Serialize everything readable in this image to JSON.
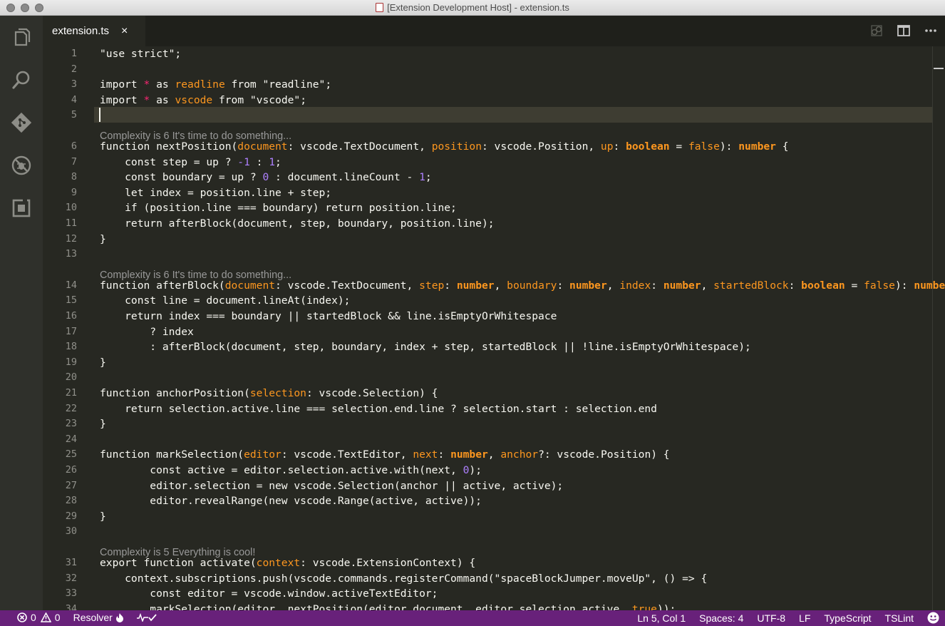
{
  "window": {
    "title": "[Extension Development Host] - extension.ts"
  },
  "activity_bar": {
    "items": [
      {
        "icon": "files-icon"
      },
      {
        "icon": "search-icon"
      },
      {
        "icon": "git-icon"
      },
      {
        "icon": "debug-icon"
      },
      {
        "icon": "extensions-icon"
      }
    ]
  },
  "tabs": [
    {
      "label": "extension.ts",
      "close": "×",
      "active": true
    }
  ],
  "editor": {
    "cursor": {
      "line": 5,
      "column": 1
    },
    "lines": [
      {
        "n": "1",
        "tokens": [
          [
            "\"use strict\";",
            "def"
          ]
        ]
      },
      {
        "n": "2",
        "tokens": []
      },
      {
        "n": "3",
        "tokens": [
          [
            "import ",
            "def"
          ],
          [
            "*",
            "op"
          ],
          [
            " as ",
            "def"
          ],
          [
            "readline",
            "ns"
          ],
          [
            " from \"readline\";",
            "def"
          ]
        ]
      },
      {
        "n": "4",
        "tokens": [
          [
            "import ",
            "def"
          ],
          [
            "*",
            "op"
          ],
          [
            " as ",
            "def"
          ],
          [
            "vscode",
            "ns"
          ],
          [
            " from \"vscode\";",
            "def"
          ]
        ]
      },
      {
        "n": "5",
        "tokens": []
      },
      {
        "lens": "Complexity is 6 It's time to do something..."
      },
      {
        "n": "6",
        "tokens": [
          [
            "function nextPosition(",
            "def"
          ],
          [
            "document",
            "prm"
          ],
          [
            ": vscode.TextDocument, ",
            "def"
          ],
          [
            "position",
            "prm"
          ],
          [
            ": vscode.Position, ",
            "def"
          ],
          [
            "up",
            "prm"
          ],
          [
            ": ",
            "def"
          ],
          [
            "boolean",
            "bold"
          ],
          [
            " = ",
            "def"
          ],
          [
            "false",
            "prm"
          ],
          [
            "): ",
            "def"
          ],
          [
            "number",
            "bold"
          ],
          [
            " {",
            "def"
          ]
        ]
      },
      {
        "n": "7",
        "tokens": [
          [
            "    const step = up ? ",
            "def"
          ],
          [
            "-1",
            "num"
          ],
          [
            " : ",
            "def"
          ],
          [
            "1",
            "num"
          ],
          [
            ";",
            "def"
          ]
        ]
      },
      {
        "n": "8",
        "tokens": [
          [
            "    const boundary = up ? ",
            "def"
          ],
          [
            "0",
            "num"
          ],
          [
            " : document.lineCount - ",
            "def"
          ],
          [
            "1",
            "num"
          ],
          [
            ";",
            "def"
          ]
        ]
      },
      {
        "n": "9",
        "tokens": [
          [
            "    let index = position.line + step;",
            "def"
          ]
        ]
      },
      {
        "n": "10",
        "tokens": [
          [
            "    if (position.line === boundary) return position.line;",
            "def"
          ]
        ]
      },
      {
        "n": "11",
        "tokens": [
          [
            "    return afterBlock(document, step, boundary, position.line);",
            "def"
          ]
        ]
      },
      {
        "n": "12",
        "tokens": [
          [
            "}",
            "def"
          ]
        ]
      },
      {
        "n": "13",
        "tokens": []
      },
      {
        "lens": "Complexity is 6 It's time to do something..."
      },
      {
        "n": "14",
        "tokens": [
          [
            "function afterBlock(",
            "def"
          ],
          [
            "document",
            "prm"
          ],
          [
            ": vscode.TextDocument, ",
            "def"
          ],
          [
            "step",
            "prm"
          ],
          [
            ": ",
            "def"
          ],
          [
            "number",
            "bold"
          ],
          [
            ", ",
            "def"
          ],
          [
            "boundary",
            "prm"
          ],
          [
            ": ",
            "def"
          ],
          [
            "number",
            "bold"
          ],
          [
            ", ",
            "def"
          ],
          [
            "index",
            "prm"
          ],
          [
            ": ",
            "def"
          ],
          [
            "number",
            "bold"
          ],
          [
            ", ",
            "def"
          ],
          [
            "startedBlock",
            "prm"
          ],
          [
            ": ",
            "def"
          ],
          [
            "boolean",
            "bold"
          ],
          [
            " = ",
            "def"
          ],
          [
            "false",
            "prm"
          ],
          [
            "): ",
            "def"
          ],
          [
            "number",
            "bold"
          ]
        ]
      },
      {
        "n": "15",
        "tokens": [
          [
            "    const line = document.lineAt(index);",
            "def"
          ]
        ]
      },
      {
        "n": "16",
        "tokens": [
          [
            "    return index === boundary || startedBlock && line.isEmptyOrWhitespace",
            "def"
          ]
        ]
      },
      {
        "n": "17",
        "tokens": [
          [
            "        ? index",
            "def"
          ]
        ]
      },
      {
        "n": "18",
        "tokens": [
          [
            "        : afterBlock(document, step, boundary, index + step, startedBlock || !line.isEmptyOrWhitespace);",
            "def"
          ]
        ]
      },
      {
        "n": "19",
        "tokens": [
          [
            "}",
            "def"
          ]
        ]
      },
      {
        "n": "20",
        "tokens": []
      },
      {
        "n": "21",
        "tokens": [
          [
            "function anchorPosition(",
            "def"
          ],
          [
            "selection",
            "prm"
          ],
          [
            ": vscode.Selection) {",
            "def"
          ]
        ]
      },
      {
        "n": "22",
        "tokens": [
          [
            "    return selection.active.line === selection.end.line ? selection.start : selection.end",
            "def"
          ]
        ]
      },
      {
        "n": "23",
        "tokens": [
          [
            "}",
            "def"
          ]
        ]
      },
      {
        "n": "24",
        "tokens": []
      },
      {
        "n": "25",
        "tokens": [
          [
            "function markSelection(",
            "def"
          ],
          [
            "editor",
            "prm"
          ],
          [
            ": vscode.TextEditor, ",
            "def"
          ],
          [
            "next",
            "prm"
          ],
          [
            ": ",
            "def"
          ],
          [
            "number",
            "bold"
          ],
          [
            ", ",
            "def"
          ],
          [
            "anchor",
            "prm"
          ],
          [
            "?: vscode.Position) {",
            "def"
          ]
        ]
      },
      {
        "n": "26",
        "tokens": [
          [
            "        const active = editor.selection.active.with(next, ",
            "def"
          ],
          [
            "0",
            "num"
          ],
          [
            ");",
            "def"
          ]
        ]
      },
      {
        "n": "27",
        "tokens": [
          [
            "        editor.selection = new vscode.Selection(anchor || active, active);",
            "def"
          ]
        ]
      },
      {
        "n": "28",
        "tokens": [
          [
            "        editor.revealRange(new vscode.Range(active, active));",
            "def"
          ]
        ]
      },
      {
        "n": "29",
        "tokens": [
          [
            "}",
            "def"
          ]
        ]
      },
      {
        "n": "30",
        "tokens": []
      },
      {
        "lens": "Complexity is 5 Everything is cool!"
      },
      {
        "n": "31",
        "tokens": [
          [
            "export function activate(",
            "def"
          ],
          [
            "context",
            "prm"
          ],
          [
            ": vscode.ExtensionContext) {",
            "def"
          ]
        ]
      },
      {
        "n": "32",
        "tokens": [
          [
            "    context.subscriptions.push(vscode.commands.registerCommand(\"spaceBlockJumper.moveUp\", () => {",
            "def"
          ]
        ]
      },
      {
        "n": "33",
        "tokens": [
          [
            "        const editor = vscode.window.activeTextEditor;",
            "def"
          ]
        ]
      },
      {
        "n": "34",
        "tokens": [
          [
            "        markSelection(editor, nextPosition(editor.document, editor.selection.active, ",
            "def"
          ],
          [
            "true",
            "prm"
          ],
          [
            "));",
            "def"
          ]
        ]
      }
    ]
  },
  "status_bar": {
    "errors": "0",
    "warnings": "0",
    "resolver": "Resolver",
    "position": "Ln 5, Col 1",
    "indent": "Spaces: 4",
    "encoding": "UTF-8",
    "eol": "LF",
    "language": "TypeScript",
    "linter": "TSLint"
  }
}
